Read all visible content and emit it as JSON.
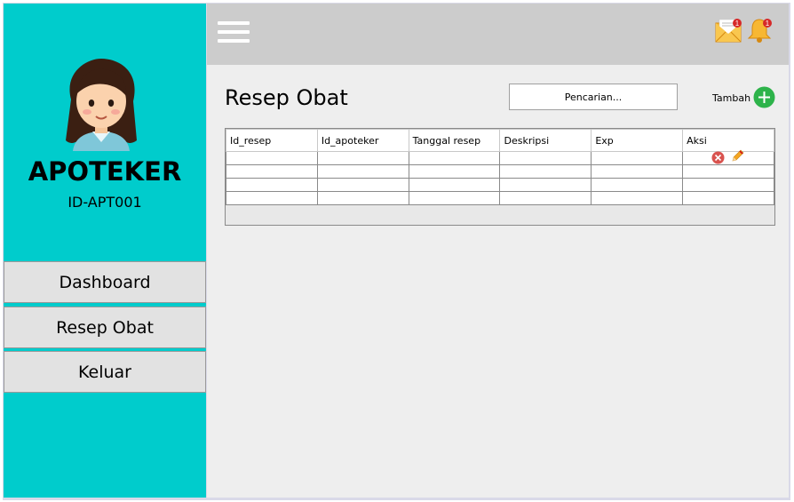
{
  "sidebar": {
    "role": "APOTEKER",
    "user_id": "ID-APT001",
    "nav": [
      {
        "label": "Dashboard"
      },
      {
        "label": "Resep Obat"
      },
      {
        "label": "Keluar"
      }
    ]
  },
  "topbar": {
    "mail_badge": "1",
    "bell_badge": "1"
  },
  "main": {
    "title": "Resep Obat",
    "search_placeholder": "Pencarian...",
    "add_label": "Tambah"
  },
  "table": {
    "columns": [
      "Id_resep",
      "Id_apoteker",
      "Tanggal resep",
      "Deskripsi",
      "Exp",
      "Aksi"
    ],
    "rows": [
      [
        "",
        "",
        "",
        "",
        "",
        ""
      ],
      [
        "",
        "",
        "",
        "",
        "",
        ""
      ],
      [
        "",
        "",
        "",
        "",
        "",
        ""
      ],
      [
        "",
        "",
        "",
        "",
        "",
        ""
      ]
    ]
  },
  "colors": {
    "sidebar": "#00cccc",
    "topbar": "#cccccc",
    "main": "#eeeeee",
    "add_button": "#2db34a",
    "delete_icon": "#d9534f"
  }
}
